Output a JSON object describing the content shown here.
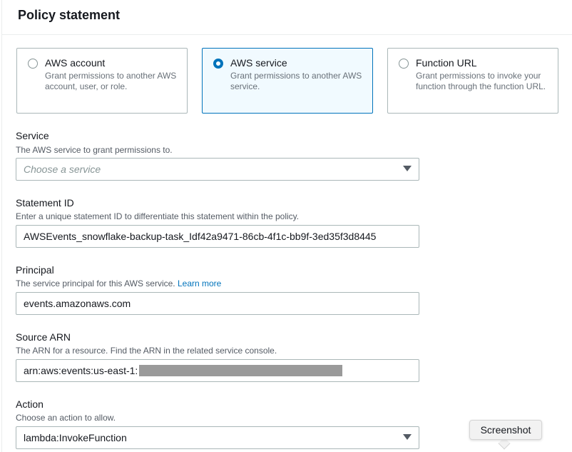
{
  "page_title": "Policy statement",
  "tiles": [
    {
      "title": "AWS account",
      "desc": "Grant permissions to another AWS account, user, or role.",
      "selected": false
    },
    {
      "title": "AWS service",
      "desc": "Grant permissions to another AWS service.",
      "selected": true
    },
    {
      "title": "Function URL",
      "desc": "Grant permissions to invoke your function through the function URL.",
      "selected": false
    }
  ],
  "service": {
    "label": "Service",
    "desc": "The AWS service to grant permissions to.",
    "placeholder": "Choose a service"
  },
  "statement_id": {
    "label": "Statement ID",
    "desc": "Enter a unique statement ID to differentiate this statement within the policy.",
    "value": "AWSEvents_snowflake-backup-task_Idf42a9471-86cb-4f1c-bb9f-3ed35f3d8445"
  },
  "principal": {
    "label": "Principal",
    "desc": "The service principal for this AWS service.",
    "link": "Learn more",
    "value": "events.amazonaws.com"
  },
  "source_arn": {
    "label": "Source ARN",
    "desc": "The ARN for a resource. Find the ARN in the related service console.",
    "value": "arn:aws:events:us-east-1:"
  },
  "action": {
    "label": "Action",
    "desc": "Choose an action to allow.",
    "value": "lambda:InvokeFunction"
  },
  "tooltip": "Screenshot",
  "colors": {
    "accent": "#0073bb",
    "selected_bg": "#f1faff",
    "border": "#aab7b8"
  }
}
